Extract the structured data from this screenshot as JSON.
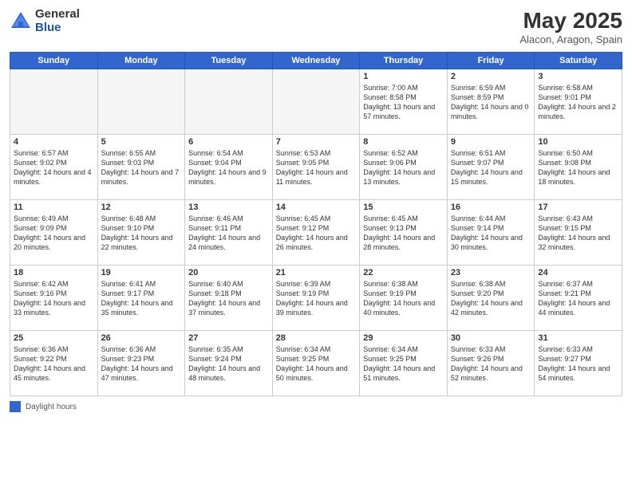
{
  "header": {
    "logo_general": "General",
    "logo_blue": "Blue",
    "title": "May 2025",
    "location": "Alacon, Aragon, Spain"
  },
  "days_of_week": [
    "Sunday",
    "Monday",
    "Tuesday",
    "Wednesday",
    "Thursday",
    "Friday",
    "Saturday"
  ],
  "legend": {
    "label": "Daylight hours"
  },
  "weeks": [
    [
      {
        "day": "",
        "info": ""
      },
      {
        "day": "",
        "info": ""
      },
      {
        "day": "",
        "info": ""
      },
      {
        "day": "",
        "info": ""
      },
      {
        "day": "1",
        "info": "Sunrise: 7:00 AM\nSunset: 8:58 PM\nDaylight: 13 hours and 57 minutes."
      },
      {
        "day": "2",
        "info": "Sunrise: 6:59 AM\nSunset: 8:59 PM\nDaylight: 14 hours and 0 minutes."
      },
      {
        "day": "3",
        "info": "Sunrise: 6:58 AM\nSunset: 9:01 PM\nDaylight: 14 hours and 2 minutes."
      }
    ],
    [
      {
        "day": "4",
        "info": "Sunrise: 6:57 AM\nSunset: 9:02 PM\nDaylight: 14 hours and 4 minutes."
      },
      {
        "day": "5",
        "info": "Sunrise: 6:55 AM\nSunset: 9:03 PM\nDaylight: 14 hours and 7 minutes."
      },
      {
        "day": "6",
        "info": "Sunrise: 6:54 AM\nSunset: 9:04 PM\nDaylight: 14 hours and 9 minutes."
      },
      {
        "day": "7",
        "info": "Sunrise: 6:53 AM\nSunset: 9:05 PM\nDaylight: 14 hours and 11 minutes."
      },
      {
        "day": "8",
        "info": "Sunrise: 6:52 AM\nSunset: 9:06 PM\nDaylight: 14 hours and 13 minutes."
      },
      {
        "day": "9",
        "info": "Sunrise: 6:51 AM\nSunset: 9:07 PM\nDaylight: 14 hours and 15 minutes."
      },
      {
        "day": "10",
        "info": "Sunrise: 6:50 AM\nSunset: 9:08 PM\nDaylight: 14 hours and 18 minutes."
      }
    ],
    [
      {
        "day": "11",
        "info": "Sunrise: 6:49 AM\nSunset: 9:09 PM\nDaylight: 14 hours and 20 minutes."
      },
      {
        "day": "12",
        "info": "Sunrise: 6:48 AM\nSunset: 9:10 PM\nDaylight: 14 hours and 22 minutes."
      },
      {
        "day": "13",
        "info": "Sunrise: 6:46 AM\nSunset: 9:11 PM\nDaylight: 14 hours and 24 minutes."
      },
      {
        "day": "14",
        "info": "Sunrise: 6:45 AM\nSunset: 9:12 PM\nDaylight: 14 hours and 26 minutes."
      },
      {
        "day": "15",
        "info": "Sunrise: 6:45 AM\nSunset: 9:13 PM\nDaylight: 14 hours and 28 minutes."
      },
      {
        "day": "16",
        "info": "Sunrise: 6:44 AM\nSunset: 9:14 PM\nDaylight: 14 hours and 30 minutes."
      },
      {
        "day": "17",
        "info": "Sunrise: 6:43 AM\nSunset: 9:15 PM\nDaylight: 14 hours and 32 minutes."
      }
    ],
    [
      {
        "day": "18",
        "info": "Sunrise: 6:42 AM\nSunset: 9:16 PM\nDaylight: 14 hours and 33 minutes."
      },
      {
        "day": "19",
        "info": "Sunrise: 6:41 AM\nSunset: 9:17 PM\nDaylight: 14 hours and 35 minutes."
      },
      {
        "day": "20",
        "info": "Sunrise: 6:40 AM\nSunset: 9:18 PM\nDaylight: 14 hours and 37 minutes."
      },
      {
        "day": "21",
        "info": "Sunrise: 6:39 AM\nSunset: 9:19 PM\nDaylight: 14 hours and 39 minutes."
      },
      {
        "day": "22",
        "info": "Sunrise: 6:38 AM\nSunset: 9:19 PM\nDaylight: 14 hours and 40 minutes."
      },
      {
        "day": "23",
        "info": "Sunrise: 6:38 AM\nSunset: 9:20 PM\nDaylight: 14 hours and 42 minutes."
      },
      {
        "day": "24",
        "info": "Sunrise: 6:37 AM\nSunset: 9:21 PM\nDaylight: 14 hours and 44 minutes."
      }
    ],
    [
      {
        "day": "25",
        "info": "Sunrise: 6:36 AM\nSunset: 9:22 PM\nDaylight: 14 hours and 45 minutes."
      },
      {
        "day": "26",
        "info": "Sunrise: 6:36 AM\nSunset: 9:23 PM\nDaylight: 14 hours and 47 minutes."
      },
      {
        "day": "27",
        "info": "Sunrise: 6:35 AM\nSunset: 9:24 PM\nDaylight: 14 hours and 48 minutes."
      },
      {
        "day": "28",
        "info": "Sunrise: 6:34 AM\nSunset: 9:25 PM\nDaylight: 14 hours and 50 minutes."
      },
      {
        "day": "29",
        "info": "Sunrise: 6:34 AM\nSunset: 9:25 PM\nDaylight: 14 hours and 51 minutes."
      },
      {
        "day": "30",
        "info": "Sunrise: 6:33 AM\nSunset: 9:26 PM\nDaylight: 14 hours and 52 minutes."
      },
      {
        "day": "31",
        "info": "Sunrise: 6:33 AM\nSunset: 9:27 PM\nDaylight: 14 hours and 54 minutes."
      }
    ]
  ]
}
